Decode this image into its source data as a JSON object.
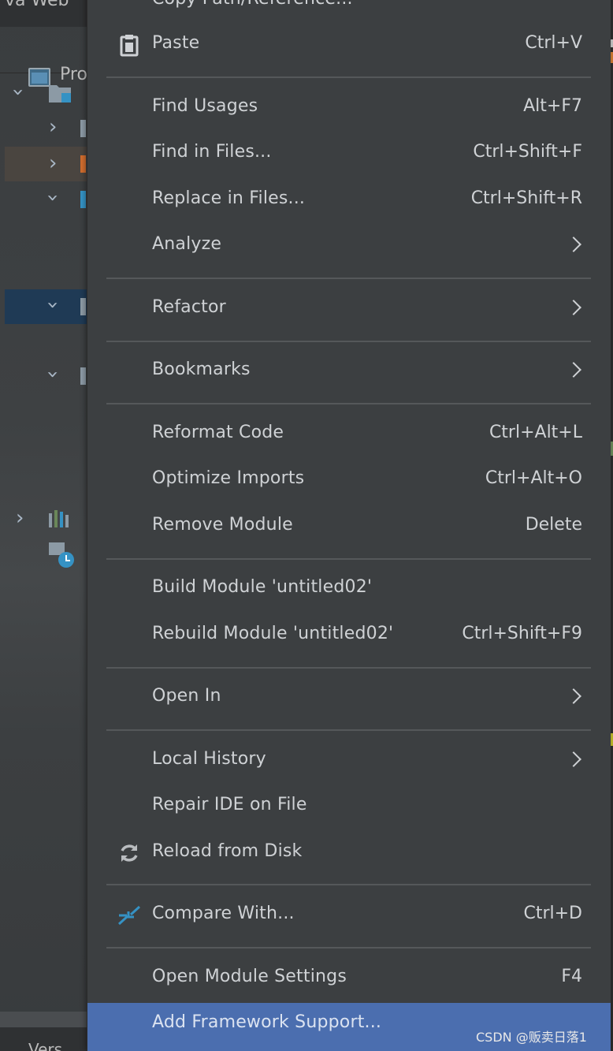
{
  "background": {
    "window_title_fragment": "va Web",
    "project_tab": "Pro",
    "bottom_tab": "Vers"
  },
  "menu": {
    "items": [
      {
        "label": "Copy Path/Reference...",
        "shortcut": "",
        "submenu": false,
        "icon": ""
      },
      {
        "label": "Paste",
        "shortcut": "Ctrl+V",
        "submenu": false,
        "icon": "clipboard-icon"
      },
      {
        "label": "Find Usages",
        "shortcut": "Alt+F7",
        "submenu": false,
        "icon": ""
      },
      {
        "label": "Find in Files...",
        "shortcut": "Ctrl+Shift+F",
        "submenu": false,
        "icon": ""
      },
      {
        "label": "Replace in Files...",
        "shortcut": "Ctrl+Shift+R",
        "submenu": false,
        "icon": ""
      },
      {
        "label": "Analyze",
        "shortcut": "",
        "submenu": true,
        "icon": ""
      },
      {
        "label": "Refactor",
        "shortcut": "",
        "submenu": true,
        "icon": ""
      },
      {
        "label": "Bookmarks",
        "shortcut": "",
        "submenu": true,
        "icon": ""
      },
      {
        "label": "Reformat Code",
        "shortcut": "Ctrl+Alt+L",
        "submenu": false,
        "icon": ""
      },
      {
        "label": "Optimize Imports",
        "shortcut": "Ctrl+Alt+O",
        "submenu": false,
        "icon": ""
      },
      {
        "label": "Remove Module",
        "shortcut": "Delete",
        "submenu": false,
        "icon": ""
      },
      {
        "label": "Build Module 'untitled02'",
        "shortcut": "",
        "submenu": false,
        "icon": ""
      },
      {
        "label": "Rebuild Module 'untitled02'",
        "shortcut": "Ctrl+Shift+F9",
        "submenu": false,
        "icon": ""
      },
      {
        "label": "Open In",
        "shortcut": "",
        "submenu": true,
        "icon": ""
      },
      {
        "label": "Local History",
        "shortcut": "",
        "submenu": true,
        "icon": ""
      },
      {
        "label": "Repair IDE on File",
        "shortcut": "",
        "submenu": false,
        "icon": ""
      },
      {
        "label": "Reload from Disk",
        "shortcut": "",
        "submenu": false,
        "icon": "reload-icon"
      },
      {
        "label": "Compare With...",
        "shortcut": "Ctrl+D",
        "submenu": false,
        "icon": "compare-arrows-icon"
      },
      {
        "label": "Open Module Settings",
        "shortcut": "F4",
        "submenu": false,
        "icon": ""
      },
      {
        "label": "Add Framework Support...",
        "shortcut": "",
        "submenu": false,
        "icon": "",
        "selected": true
      }
    ]
  },
  "watermark": "CSDN @贩卖日落1",
  "colors": {
    "menu_bg": "#3c3f41",
    "selection": "#4b6eaf",
    "text": "#cfd2d5",
    "separator": "#55585a"
  }
}
